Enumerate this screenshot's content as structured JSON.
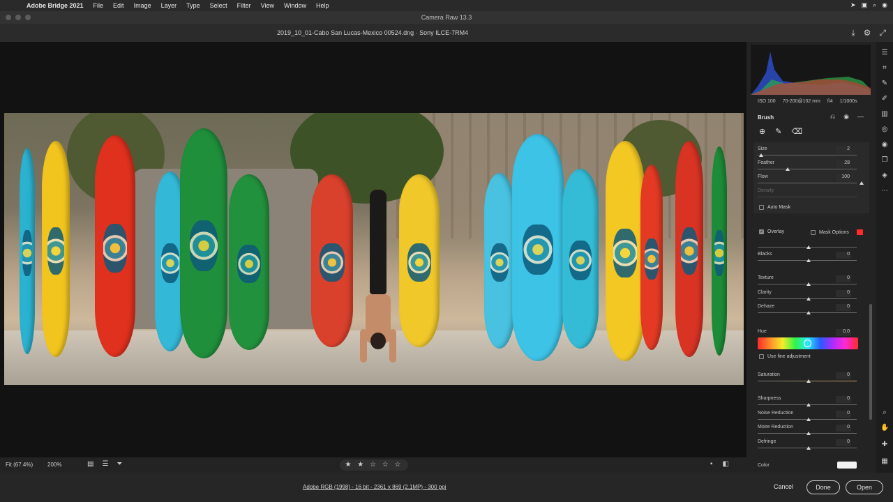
{
  "menubar": {
    "app": "Adobe Bridge 2021",
    "items": [
      "File",
      "Edit",
      "Image",
      "Layer",
      "Type",
      "Select",
      "Filter",
      "View",
      "Window",
      "Help"
    ]
  },
  "window": {
    "title": "Camera Raw 13.3"
  },
  "document": {
    "filename": "2019_10_01-Cabo San Lucas-Mexico 00524.dng  ·  Sony ILCE-7RM4"
  },
  "exif": {
    "iso": "ISO 100",
    "lens": "70-200@102 mm",
    "aperture": "f/4",
    "shutter": "1/1000s"
  },
  "brush": {
    "title": "Brush",
    "size": {
      "label": "Size",
      "value": "2"
    },
    "feather": {
      "label": "Feather",
      "value": "28"
    },
    "flow": {
      "label": "Flow",
      "value": "100"
    },
    "density": {
      "label": "Density"
    },
    "auto_mask": "Auto Mask",
    "overlay": "Overlay",
    "mask_options": "Mask Options"
  },
  "sliders": {
    "blacks": {
      "label": "Blacks",
      "value": "0"
    },
    "texture": {
      "label": "Texture",
      "value": "0"
    },
    "clarity": {
      "label": "Clarity",
      "value": "0"
    },
    "dehaze": {
      "label": "Dehaze",
      "value": "0"
    },
    "hue": {
      "label": "Hue",
      "value": "0.0"
    },
    "use_fine": "Use fine adjustment",
    "saturation": {
      "label": "Saturation",
      "value": "0"
    },
    "sharpness": {
      "label": "Sharpness",
      "value": "0"
    },
    "noise": {
      "label": "Noise Reduction",
      "value": "0"
    },
    "moire": {
      "label": "Moire Reduction",
      "value": "0"
    },
    "defringe": {
      "label": "Defringe",
      "value": "0"
    },
    "color": {
      "label": "Color"
    }
  },
  "bottombar": {
    "fit": "Fit (67.4%)",
    "zoom": "200%",
    "stars": "★ ★ ☆ ☆ ☆"
  },
  "footer": {
    "info": "Adobe RGB (1998) - 16 bit - 2361 x 869 (2.1MP) - 300 ppi",
    "cancel": "Cancel",
    "done": "Done",
    "open": "Open"
  },
  "colors": {
    "accent": "#3e93d8",
    "mask_swatch": "#ff2a2a"
  }
}
